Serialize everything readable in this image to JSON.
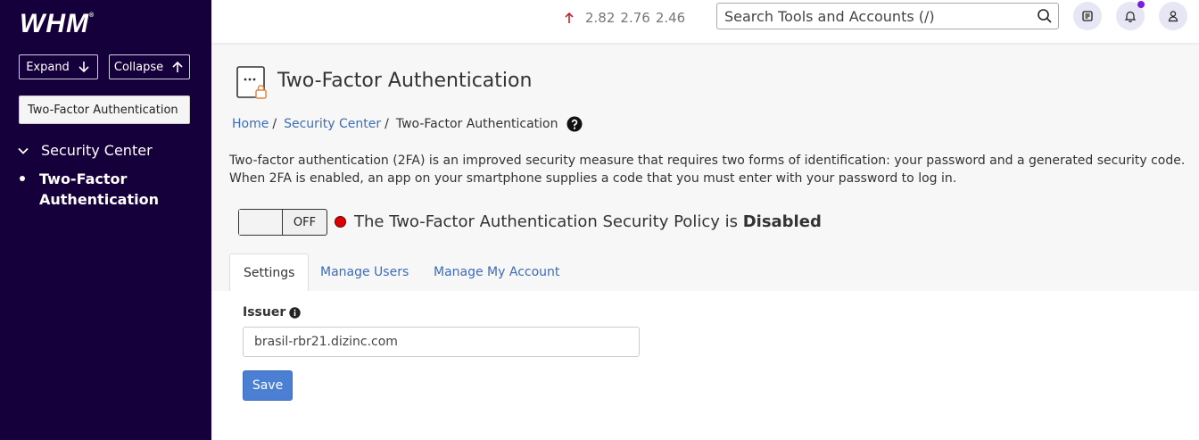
{
  "sidebar": {
    "logo": "WHM",
    "logo_mark": "®",
    "expand_label": "Expand",
    "collapse_label": "Collapse",
    "search_value": "Two-Factor Authentication",
    "group_label": "Security Center",
    "item_label": "Two-Factor Authentication"
  },
  "topbar": {
    "load": [
      "2.82",
      "2.76",
      "2.46"
    ],
    "search_placeholder": "Search Tools and Accounts (/)"
  },
  "page": {
    "title": "Two-Factor Authentication",
    "breadcrumb": {
      "home": "Home",
      "section": "Security Center",
      "current": "Two-Factor Authentication"
    },
    "description": "Two-factor authentication (2FA) is an improved security measure that requires two forms of identification: your password and a generated security code. When 2FA is enabled, an app on your smartphone supplies a code that you must enter with your password to log in.",
    "toggle_label": "OFF",
    "status_prefix": "The Two-Factor Authentication Security Policy is ",
    "status_value": "Disabled"
  },
  "tabs": [
    "Settings",
    "Manage Users",
    "Manage My Account"
  ],
  "form": {
    "issuer_label": "Issuer",
    "issuer_value": "brasil-rbr21.dizinc.com",
    "save_label": "Save"
  },
  "colors": {
    "sidebar_bg": "#16003b",
    "link": "#3d6cb9",
    "primary_button": "#4a7fd4",
    "status_dot": "#dd0000",
    "notification_dot": "#7a1ee6"
  }
}
